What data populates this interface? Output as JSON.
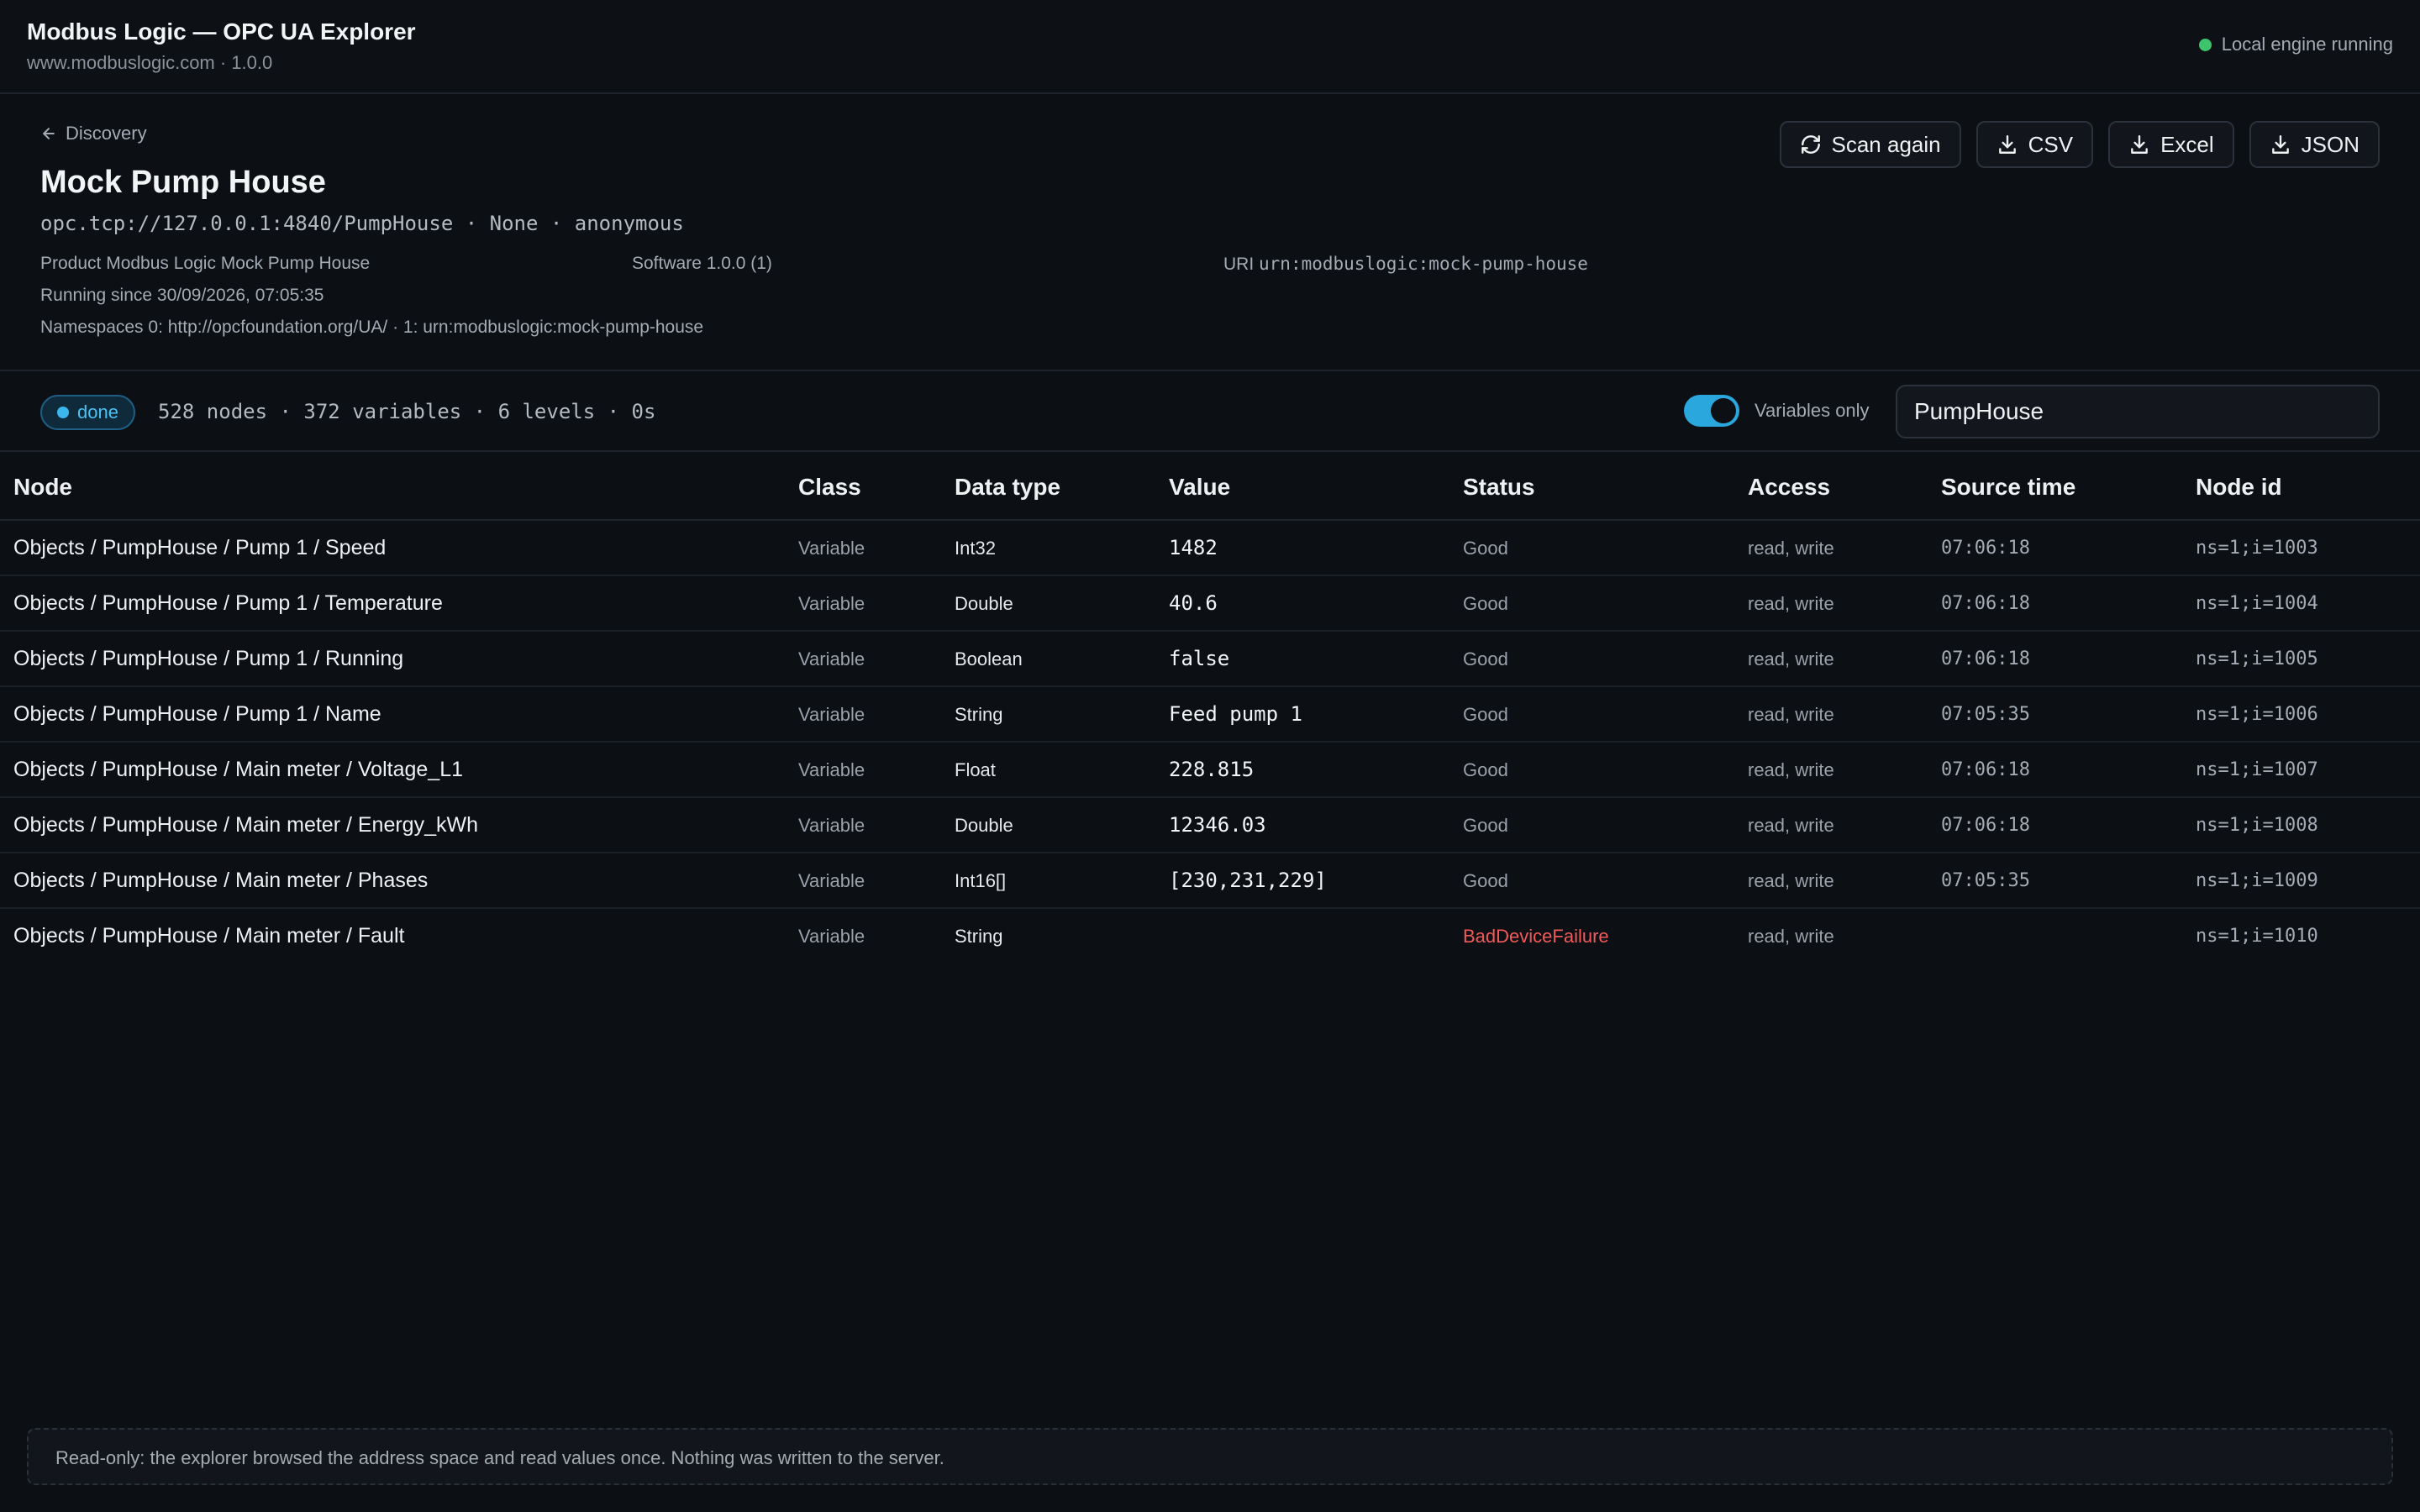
{
  "app": {
    "title": "Modbus Logic — OPC UA Explorer",
    "subtitle": "www.modbuslogic.com · 1.0.0",
    "engine_status": "Local engine running"
  },
  "header": {
    "back_label": "Discovery",
    "server_name": "Mock Pump House",
    "endpoint": "opc.tcp://127.0.0.1:4840/PumpHouse · None · anonymous",
    "product": "Product Modbus Logic Mock Pump House",
    "software": "Software 1.0.0 (1)",
    "uri_label": "URI",
    "uri_value": "urn:modbuslogic:mock-pump-house",
    "running_since": "Running since 30/09/2026, 07:05:35",
    "namespaces": "Namespaces 0: http://opcfoundation.org/UA/ · 1: urn:modbuslogic:mock-pump-house",
    "actions": {
      "scan_again": "Scan again",
      "csv": "CSV",
      "excel": "Excel",
      "json": "JSON"
    }
  },
  "status": {
    "badge": "done",
    "stats": "528 nodes · 372 variables · 6 levels · 0s",
    "variables_only_label": "Variables only",
    "variables_only": true,
    "search_value": "PumpHouse"
  },
  "table": {
    "columns": [
      "Node",
      "Class",
      "Data type",
      "Value",
      "Status",
      "Access",
      "Source time",
      "Node id"
    ],
    "rows": [
      {
        "node": "Objects / PumpHouse / Pump 1 / Speed",
        "class": "Variable",
        "type": "Int32",
        "value": "1482",
        "status": "Good",
        "access": "read, write",
        "time": "07:06:18",
        "id": "ns=1;i=1003"
      },
      {
        "node": "Objects / PumpHouse / Pump 1 / Temperature",
        "class": "Variable",
        "type": "Double",
        "value": "40.6",
        "status": "Good",
        "access": "read, write",
        "time": "07:06:18",
        "id": "ns=1;i=1004"
      },
      {
        "node": "Objects / PumpHouse / Pump 1 / Running",
        "class": "Variable",
        "type": "Boolean",
        "value": "false",
        "status": "Good",
        "access": "read, write",
        "time": "07:06:18",
        "id": "ns=1;i=1005"
      },
      {
        "node": "Objects / PumpHouse / Pump 1 / Name",
        "class": "Variable",
        "type": "String",
        "value": "Feed pump 1",
        "status": "Good",
        "access": "read, write",
        "time": "07:05:35",
        "id": "ns=1;i=1006"
      },
      {
        "node": "Objects / PumpHouse / Main meter / Voltage_L1",
        "class": "Variable",
        "type": "Float",
        "value": "228.815",
        "status": "Good",
        "access": "read, write",
        "time": "07:06:18",
        "id": "ns=1;i=1007"
      },
      {
        "node": "Objects / PumpHouse / Main meter / Energy_kWh",
        "class": "Variable",
        "type": "Double",
        "value": "12346.03",
        "status": "Good",
        "access": "read, write",
        "time": "07:06:18",
        "id": "ns=1;i=1008"
      },
      {
        "node": "Objects / PumpHouse / Main meter / Phases",
        "class": "Variable",
        "type": "Int16[]",
        "value": "[230,231,229]",
        "status": "Good",
        "access": "read, write",
        "time": "07:05:35",
        "id": "ns=1;i=1009"
      },
      {
        "node": "Objects / PumpHouse / Main meter / Fault",
        "class": "Variable",
        "type": "String",
        "value": "",
        "status": "BadDeviceFailure",
        "access": "read, write",
        "time": "",
        "id": "ns=1;i=1010"
      }
    ]
  },
  "footer": {
    "note": "Read-only: the explorer browsed the address space and read values once. Nothing was written to the server."
  },
  "colors": {
    "accent": "#2aa7dd",
    "bad": "#f25a5a",
    "running": "#3ec46d"
  }
}
